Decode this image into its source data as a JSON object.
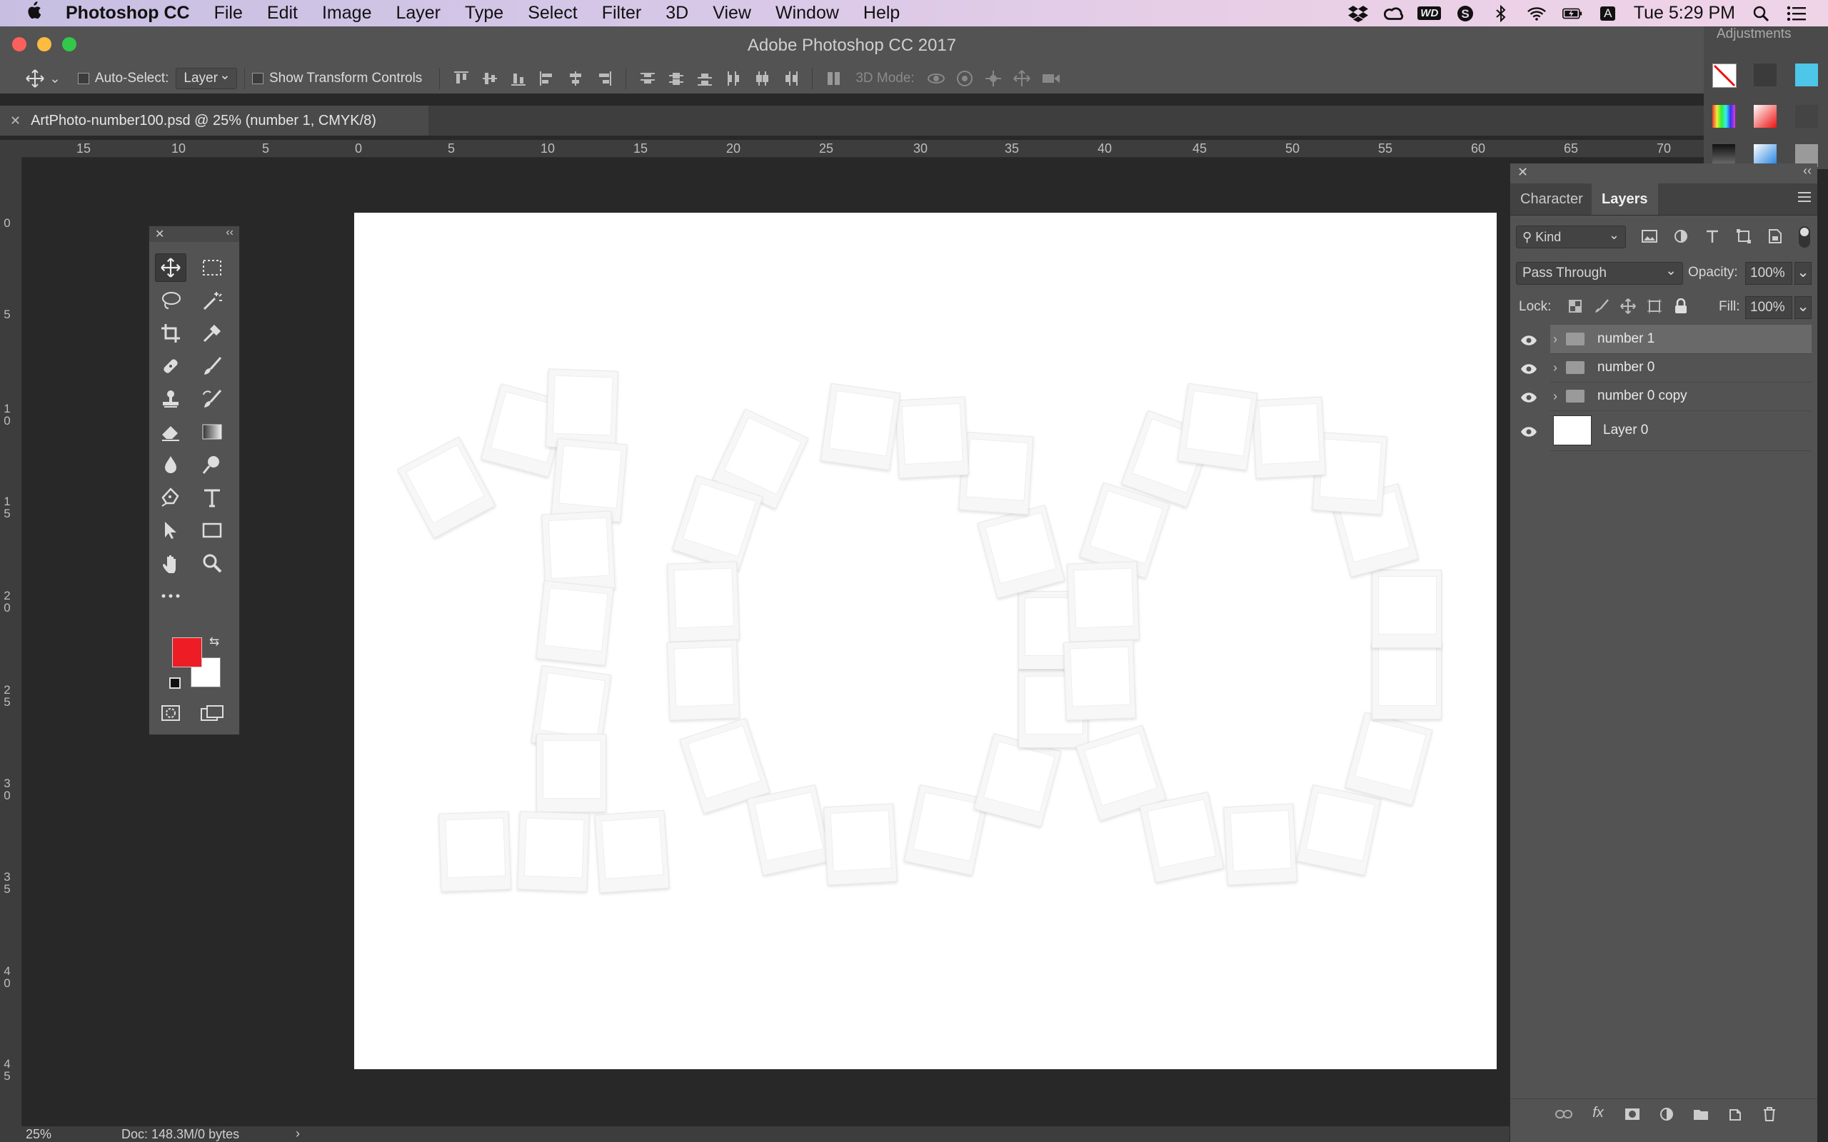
{
  "menubar": {
    "items": [
      "Photoshop CC",
      "File",
      "Edit",
      "Image",
      "Layer",
      "Type",
      "Select",
      "Filter",
      "3D",
      "View",
      "Window",
      "Help"
    ],
    "clock": "Tue 5:29 PM",
    "status_icons": [
      "dropbox-icon",
      "creative-cloud-icon",
      "wd-icon",
      "skype-icon",
      "bluetooth-icon",
      "wifi-icon",
      "battery-icon",
      "input-source-icon",
      "spotlight-icon",
      "notification-center-icon"
    ],
    "wd_label": "WD",
    "input_label": "A"
  },
  "window": {
    "title": "Adobe Photoshop CC 2017"
  },
  "options": {
    "auto_select_label": "Auto-Select:",
    "auto_select_value": "Layer",
    "show_transform_label": "Show Transform Controls",
    "mode3d_label": "3D Mode:"
  },
  "document": {
    "tab_title": "ArtPhoto-number100.psd @ 25% (number 1, CMYK/8)"
  },
  "ruler_top": [
    "15",
    "10",
    "5",
    "0",
    "5",
    "10",
    "15",
    "20",
    "25",
    "30",
    "35",
    "40",
    "45",
    "50",
    "55",
    "60",
    "65",
    "70"
  ],
  "ruler_left": [
    "0",
    "5",
    "10",
    "15",
    "20",
    "25",
    "30",
    "35",
    "40",
    "45"
  ],
  "colors": {
    "foreground": "#ee1c24",
    "background": "#ffffff",
    "accent": "#535353"
  },
  "status": {
    "zoom": "25%",
    "doc": "Doc: 148.3M/0 bytes"
  },
  "right_strip": {
    "label": "Adjustments"
  },
  "layers_panel": {
    "tabs": [
      "Character",
      "Layers"
    ],
    "filter_kind": "Kind",
    "blend_mode": "Pass Through",
    "opacity_label": "Opacity:",
    "opacity_value": "100%",
    "lock_label": "Lock:",
    "fill_label": "Fill:",
    "fill_value": "100%",
    "layers": [
      {
        "name": "number 1",
        "type": "group",
        "selected": true
      },
      {
        "name": "number 0",
        "type": "group",
        "selected": false
      },
      {
        "name": "number 0 copy",
        "type": "group",
        "selected": false
      },
      {
        "name": "Layer 0",
        "type": "pixel",
        "selected": false
      }
    ]
  }
}
